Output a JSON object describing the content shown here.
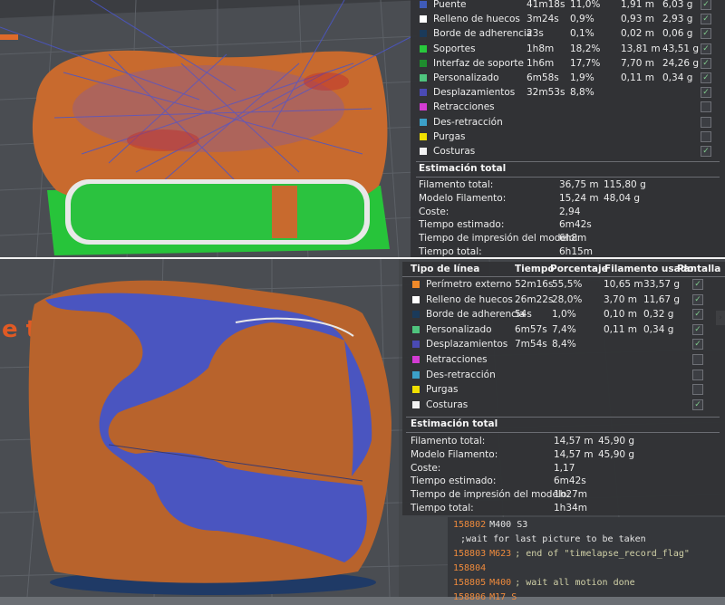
{
  "top_panel": {
    "rows": [
      {
        "label": "Puente",
        "time": "41m18s",
        "pct": "11,0%",
        "len": "1,91 m",
        "weight": "6,03 g",
        "color": "#3f5bb8",
        "checked": true
      },
      {
        "label": "Relleno de huecos",
        "time": "3m24s",
        "pct": "0,9%",
        "len": "0,93 m",
        "weight": "2,93 g",
        "color": "#ffffff",
        "checked": true
      },
      {
        "label": "Borde de adherencia",
        "time": "23s",
        "pct": "0,1%",
        "len": "0,02 m",
        "weight": "0,06 g",
        "color": "#1a3a5a",
        "checked": true
      },
      {
        "label": "Soportes",
        "time": "1h8m",
        "pct": "18,2%",
        "len": "13,81 m",
        "weight": "43,51 g",
        "color": "#28c83c",
        "checked": true
      },
      {
        "label": "Interfaz de soporte",
        "time": "1h6m",
        "pct": "17,7%",
        "len": "7,70 m",
        "weight": "24,26 g",
        "color": "#1f8c2e",
        "checked": true
      },
      {
        "label": "Personalizado",
        "time": "6m58s",
        "pct": "1,9%",
        "len": "0,11 m",
        "weight": "0,34 g",
        "color": "#4fc47e",
        "checked": true
      },
      {
        "label": "Desplazamientos",
        "time": "32m53s",
        "pct": "8,8%",
        "len": "",
        "weight": "",
        "color": "#4a4ab5",
        "checked": true
      },
      {
        "label": "Retracciones",
        "time": "",
        "pct": "",
        "len": "",
        "weight": "",
        "color": "#d43cd4",
        "checked": false
      },
      {
        "label": "Des-retracción",
        "time": "",
        "pct": "",
        "len": "",
        "weight": "",
        "color": "#3ca0c8",
        "checked": false
      },
      {
        "label": "Purgas",
        "time": "",
        "pct": "",
        "len": "",
        "weight": "",
        "color": "#f0e000",
        "checked": false
      },
      {
        "label": "Costuras",
        "time": "",
        "pct": "",
        "len": "",
        "weight": "",
        "color": "#f2f2f2",
        "checked": true
      }
    ],
    "estimate_title": "Estimación total",
    "estimate": [
      {
        "label": "Filamento total:",
        "v1": "36,75 m",
        "v2": "115,80 g"
      },
      {
        "label": "Modelo Filamento:",
        "v1": "15,24 m",
        "v2": "48,04 g"
      },
      {
        "label": "Coste:",
        "v1": "2,94",
        "v2": ""
      },
      {
        "label": "Tiempo estimado:",
        "v1": "6m42s",
        "v2": ""
      },
      {
        "label": "Tiempo de impresión del modelo:",
        "v1": "6h8m",
        "v2": ""
      },
      {
        "label": "Tiempo total:",
        "v1": "6h15m",
        "v2": ""
      }
    ]
  },
  "bottom_panel": {
    "headers": {
      "type": "Tipo de línea",
      "time": "Tiempo",
      "pct": "Porcentaje",
      "used": "Filamento usado",
      "display": "Pantalla"
    },
    "rows": [
      {
        "label": "Perímetro externo",
        "time": "52m16s",
        "pct": "55,5%",
        "len": "10,65 m",
        "weight": "33,57 g",
        "color": "#f08a2a",
        "checked": true
      },
      {
        "label": "Relleno de huecos",
        "time": "26m22s",
        "pct": "28,0%",
        "len": "3,70 m",
        "weight": "11,67 g",
        "color": "#ffffff",
        "checked": true
      },
      {
        "label": "Borde de adherencia",
        "time": "54s",
        "pct": "1,0%",
        "len": "0,10 m",
        "weight": "0,32 g",
        "color": "#1a3a5a",
        "checked": true
      },
      {
        "label": "Personalizado",
        "time": "6m57s",
        "pct": "7,4%",
        "len": "0,11 m",
        "weight": "0,34 g",
        "color": "#4fc47e",
        "checked": true
      },
      {
        "label": "Desplazamientos",
        "time": "7m54s",
        "pct": "8,4%",
        "len": "",
        "weight": "",
        "color": "#4a4ab5",
        "checked": true
      },
      {
        "label": "Retracciones",
        "time": "",
        "pct": "",
        "len": "",
        "weight": "",
        "color": "#d43cd4",
        "checked": false
      },
      {
        "label": "Des-retracción",
        "time": "",
        "pct": "",
        "len": "",
        "weight": "",
        "color": "#3ca0c8",
        "checked": false
      },
      {
        "label": "Purgas",
        "time": "",
        "pct": "",
        "len": "",
        "weight": "",
        "color": "#f0e000",
        "checked": false
      },
      {
        "label": "Costuras",
        "time": "",
        "pct": "",
        "len": "",
        "weight": "",
        "color": "#f2f2f2",
        "checked": true
      }
    ],
    "estimate_title": "Estimación total",
    "estimate": [
      {
        "label": "Filamento total:",
        "v1": "14,57 m",
        "v2": "45,90 g"
      },
      {
        "label": "Modelo Filamento:",
        "v1": "14,57 m",
        "v2": "45,90 g"
      },
      {
        "label": "Coste:",
        "v1": "1,17",
        "v2": ""
      },
      {
        "label": "Tiempo estimado:",
        "v1": "6m42s",
        "v2": ""
      },
      {
        "label": "Tiempo de impresión del modelo:",
        "v1": "1h27m",
        "v2": ""
      },
      {
        "label": "Tiempo total:",
        "v1": "1h34m",
        "v2": ""
      }
    ]
  },
  "gcode": [
    {
      "num": "158802",
      "cmd": "M400 S3",
      "cmd_color": "#e6e6e6",
      "rest": ""
    },
    {
      "num": "",
      "cmd": "",
      "cmd_color": "#e6e6e6",
      "rest": ";wait for last picture to be taken"
    },
    {
      "num": "158803",
      "cmd": "M623",
      "cmd_color": "#ee8a3c",
      "rest": "; end of \"timelapse_record_flag\""
    },
    {
      "num": "158804",
      "cmd": "",
      "cmd_color": "#e6e6e6",
      "rest": ""
    },
    {
      "num": "158805",
      "cmd": "M400",
      "cmd_color": "#ee8a3c",
      "rest": "; wait all motion done"
    },
    {
      "num": "158806",
      "cmd": "M17 S",
      "cmd_color": "#ee8a3c",
      "rest": ""
    }
  ],
  "scene": {
    "bed_text": "e t",
    "side_tab": "›"
  }
}
